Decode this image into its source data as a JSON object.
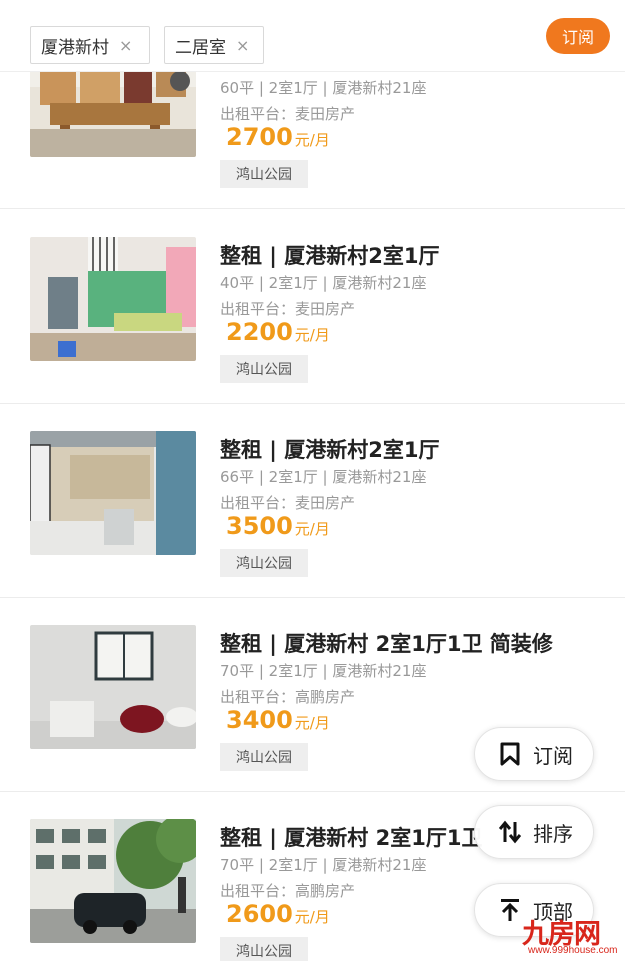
{
  "filters": [
    {
      "label": "厦港新村",
      "remove": "×"
    },
    {
      "label": "二居室",
      "remove": "×"
    }
  ],
  "subscribe_top": "订阅",
  "listings": [
    {
      "title": "",
      "meta": "60平 | 2室1厅 | 厦港新村21座",
      "platform": "出租平台：麦田房产",
      "price": "2700",
      "unit": "元/月",
      "tag": "鸿山公园"
    },
    {
      "title": "整租 | 厦港新村2室1厅",
      "meta": "40平 | 2室1厅 | 厦港新村21座",
      "platform": "出租平台：麦田房产",
      "price": "2200",
      "unit": "元/月",
      "tag": "鸿山公园"
    },
    {
      "title": "整租 | 厦港新村2室1厅",
      "meta": "66平 | 2室1厅 | 厦港新村21座",
      "platform": "出租平台：麦田房产",
      "price": "3500",
      "unit": "元/月",
      "tag": "鸿山公园"
    },
    {
      "title": "整租 | 厦港新村 2室1厅1卫 简装修",
      "meta": "70平 | 2室1厅 | 厦港新村21座",
      "platform": "出租平台：高鹏房产",
      "price": "3400",
      "unit": "元/月",
      "tag": "鸿山公园"
    },
    {
      "title": "整租 | 厦港新村 2室1厅1卫",
      "meta": "70平 | 2室1厅 | 厦港新村21座",
      "platform": "出租平台：高鹏房产",
      "price": "2600",
      "unit": "元/月",
      "tag": "鸿山公园"
    }
  ],
  "float_buttons": {
    "subscribe": "订阅",
    "sort": "排序",
    "top": "顶部"
  },
  "watermark": {
    "main": "九房网",
    "sub": "www.999house.com"
  },
  "colors": {
    "accent": "#f0781e",
    "price": "#f09a1a",
    "watermark": "#d8261b"
  },
  "icons": [
    "close-icon",
    "bookmark-icon",
    "sort-icon",
    "arrow-up-icon"
  ]
}
